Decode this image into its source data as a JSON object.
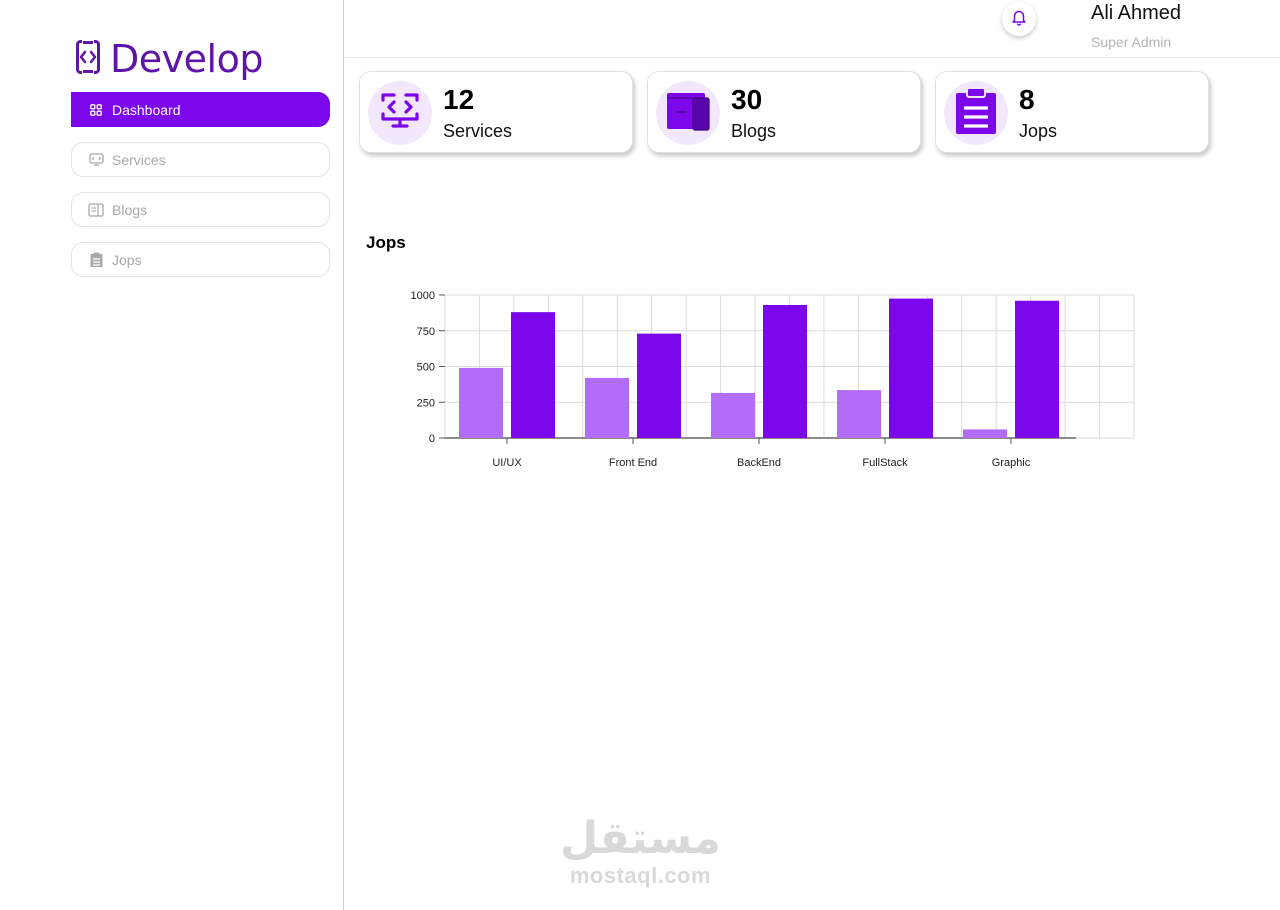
{
  "brand": {
    "name": "Develop",
    "icon": "code-brackets-icon"
  },
  "sidebar": {
    "items": [
      {
        "label": "Dashboard",
        "icon": "grid-icon",
        "active": true
      },
      {
        "label": "Services",
        "icon": "code-screen-icon",
        "active": false
      },
      {
        "label": "Blogs",
        "icon": "document-icon",
        "active": false
      },
      {
        "label": "Jops",
        "icon": "clipboard-icon",
        "active": false
      }
    ]
  },
  "header": {
    "user_name": "Ali Ahmed",
    "user_role": "Super Admin",
    "notification_icon": "bell-icon"
  },
  "stats": [
    {
      "value": "12",
      "label": "Services",
      "icon": "code-screen-icon"
    },
    {
      "value": "30",
      "label": "Blogs",
      "icon": "folder-icon"
    },
    {
      "value": "8",
      "label": "Jops",
      "icon": "clipboard-icon"
    }
  ],
  "colors": {
    "accent": "#7b07ea",
    "accent_light": "#b36cf8",
    "brand_text": "#5f14a8",
    "icon_bg": "#f3e7fd"
  },
  "chart_title": "Jops",
  "chart_data": {
    "type": "bar",
    "categories": [
      "UI/UX",
      "Front End",
      "BackEnd",
      "FullStack",
      "Graphic"
    ],
    "series": [
      {
        "values": [
          490,
          420,
          315,
          335,
          60
        ]
      },
      {
        "values": [
          880,
          730,
          930,
          975,
          960
        ]
      }
    ],
    "yticks": [
      0,
      250,
      500,
      750,
      1000
    ],
    "ylim": [
      0,
      1000
    ],
    "grid": true,
    "legend": "none"
  },
  "watermark": {
    "arabic": "مستقل",
    "latin": "mostaql.com"
  }
}
